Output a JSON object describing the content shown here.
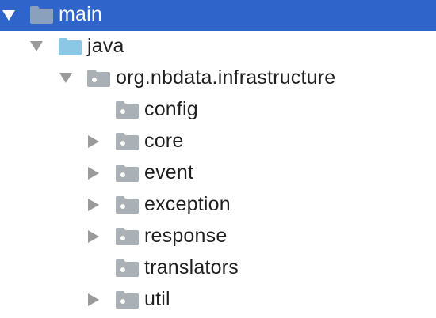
{
  "tree": {
    "nodes": [
      {
        "label": "main",
        "depth": 0,
        "expanded": true,
        "has_children": true,
        "selected": true,
        "icon": "folder-icon",
        "folder_color": "#8aa0bd"
      },
      {
        "label": "java",
        "depth": 1,
        "expanded": true,
        "has_children": true,
        "selected": false,
        "icon": "source-folder-icon",
        "folder_color": "#8bc8e6"
      },
      {
        "label": "org.nbdata.infrastructure",
        "depth": 2,
        "expanded": true,
        "has_children": true,
        "selected": false,
        "icon": "package-icon",
        "folder_color": "#a9b0b6"
      },
      {
        "label": "config",
        "depth": 3,
        "expanded": false,
        "has_children": false,
        "selected": false,
        "icon": "package-icon",
        "folder_color": "#a9b0b6"
      },
      {
        "label": "core",
        "depth": 3,
        "expanded": false,
        "has_children": true,
        "selected": false,
        "icon": "package-icon",
        "folder_color": "#a9b0b6"
      },
      {
        "label": "event",
        "depth": 3,
        "expanded": false,
        "has_children": true,
        "selected": false,
        "icon": "package-icon",
        "folder_color": "#a9b0b6"
      },
      {
        "label": "exception",
        "depth": 3,
        "expanded": false,
        "has_children": true,
        "selected": false,
        "icon": "package-icon",
        "folder_color": "#a9b0b6"
      },
      {
        "label": "response",
        "depth": 3,
        "expanded": false,
        "has_children": true,
        "selected": false,
        "icon": "package-icon",
        "folder_color": "#a9b0b6"
      },
      {
        "label": "translators",
        "depth": 3,
        "expanded": false,
        "has_children": false,
        "selected": false,
        "icon": "package-icon",
        "folder_color": "#a9b0b6"
      },
      {
        "label": "util",
        "depth": 3,
        "expanded": false,
        "has_children": true,
        "selected": false,
        "icon": "package-icon",
        "folder_color": "#a9b0b6"
      }
    ]
  },
  "colors": {
    "selection": "#2f65ca",
    "arrow": "#9b9b9b",
    "text": "#1f1f1f"
  }
}
